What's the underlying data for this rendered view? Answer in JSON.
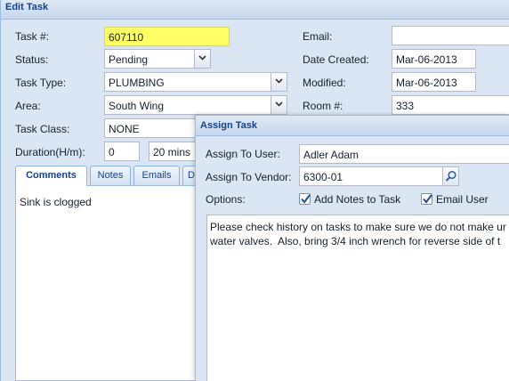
{
  "edit_task": {
    "title": "Edit Task",
    "task_no_label": "Task #:",
    "task_no_value": "607110",
    "status_label": "Status:",
    "status_value": "Pending",
    "task_type_label": "Task Type:",
    "task_type_value": "PLUMBING",
    "area_label": "Area:",
    "area_value": "South Wing",
    "task_class_label": "Task Class:",
    "task_class_value": "NONE",
    "duration_label": "Duration(H/m):",
    "duration_hours": "0",
    "duration_minutes": "20 mins",
    "email_label": "Email:",
    "email_value": "",
    "date_created_label": "Date Created:",
    "date_created_value": "Mar-06-2013",
    "modified_label": "Modified:",
    "modified_value": "Mar-06-2013",
    "room_label": "Room #:",
    "room_value": "333",
    "tabs": [
      {
        "label": "Comments"
      },
      {
        "label": "Notes"
      },
      {
        "label": "Emails"
      },
      {
        "label": "D"
      }
    ],
    "comments_text": "Sink is clogged"
  },
  "assign_task": {
    "title": "Assign Task",
    "user_label": "Assign To User:",
    "user_value": "Adler Adam",
    "vendor_label": "Assign To Vendor:",
    "vendor_value": "6300-01",
    "options_label": "Options:",
    "add_notes_label": "Add Notes to Task",
    "add_notes_checked": true,
    "email_user_label": "Email User",
    "email_user_checked": true,
    "notes_text": "Please check history on tasks to make sure we do not make ur\nwater valves.  Also, bring 3/4 inch wrench for reverse side of t"
  },
  "icons": [
    "chevron-down-icon",
    "magnifier-icon",
    "checkmark-icon"
  ],
  "colors": {
    "accent": "#15428b",
    "panel": "#dae6f3",
    "highlight": "#ffff66",
    "border": "#99bbe8"
  }
}
